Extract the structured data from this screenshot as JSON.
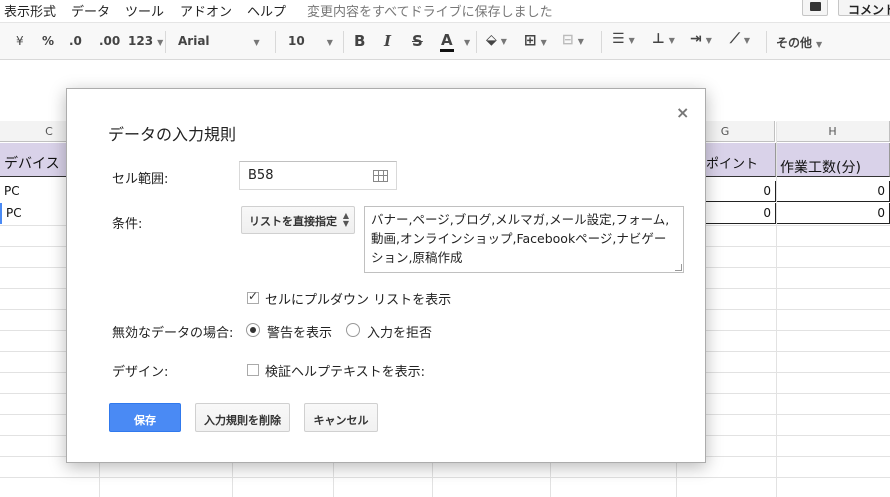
{
  "menubar": {
    "items": [
      "表示形式",
      "データ",
      "ツール",
      "アドオン",
      "ヘルプ"
    ],
    "status": "変更内容をすべてドライブに保存しました",
    "comment_label": "コメント"
  },
  "toolbar": {
    "currency": "¥",
    "percent": "%",
    "dec_decrease": ".0",
    "dec_increase": ".00",
    "format_123": "123",
    "font": "Arial",
    "font_size": "10",
    "bold": "B",
    "italic": "I",
    "strike": "S",
    "text_color": "A",
    "more": "その他"
  },
  "sheet": {
    "columns": {
      "c": "C",
      "g": "G",
      "h": "H"
    },
    "header_c": "デバイス",
    "header_g": "ポイント",
    "header_h": "作業工数(分)",
    "rows": [
      {
        "c": "PC",
        "g": "0",
        "h": "0"
      },
      {
        "c": "PC",
        "g": "0",
        "h": "0"
      }
    ]
  },
  "dialog": {
    "title": "データの入力規則",
    "close": "×",
    "range_label": "セル範囲:",
    "range_value": "B58",
    "criteria_label": "条件:",
    "criteria_type": "リストを直接指定",
    "criteria_list": "バナー,ページ,ブログ,メルマガ,メール設定,フォーム,動画,オンラインショップ,Facebookページ,ナビゲーション,原稿作成",
    "show_dropdown_label": "セルにプルダウン リストを表示",
    "show_dropdown_checked": true,
    "invalid_label": "無効なデータの場合:",
    "invalid_options": [
      "警告を表示",
      "入力を拒否"
    ],
    "invalid_selected": 0,
    "design_label": "デザイン:",
    "help_text_label": "検証ヘルプテキストを表示:",
    "help_text_checked": false,
    "save_label": "保存",
    "delete_label": "入力規則を削除",
    "cancel_label": "キャンセル",
    "primary_color": "#4a8af4"
  }
}
